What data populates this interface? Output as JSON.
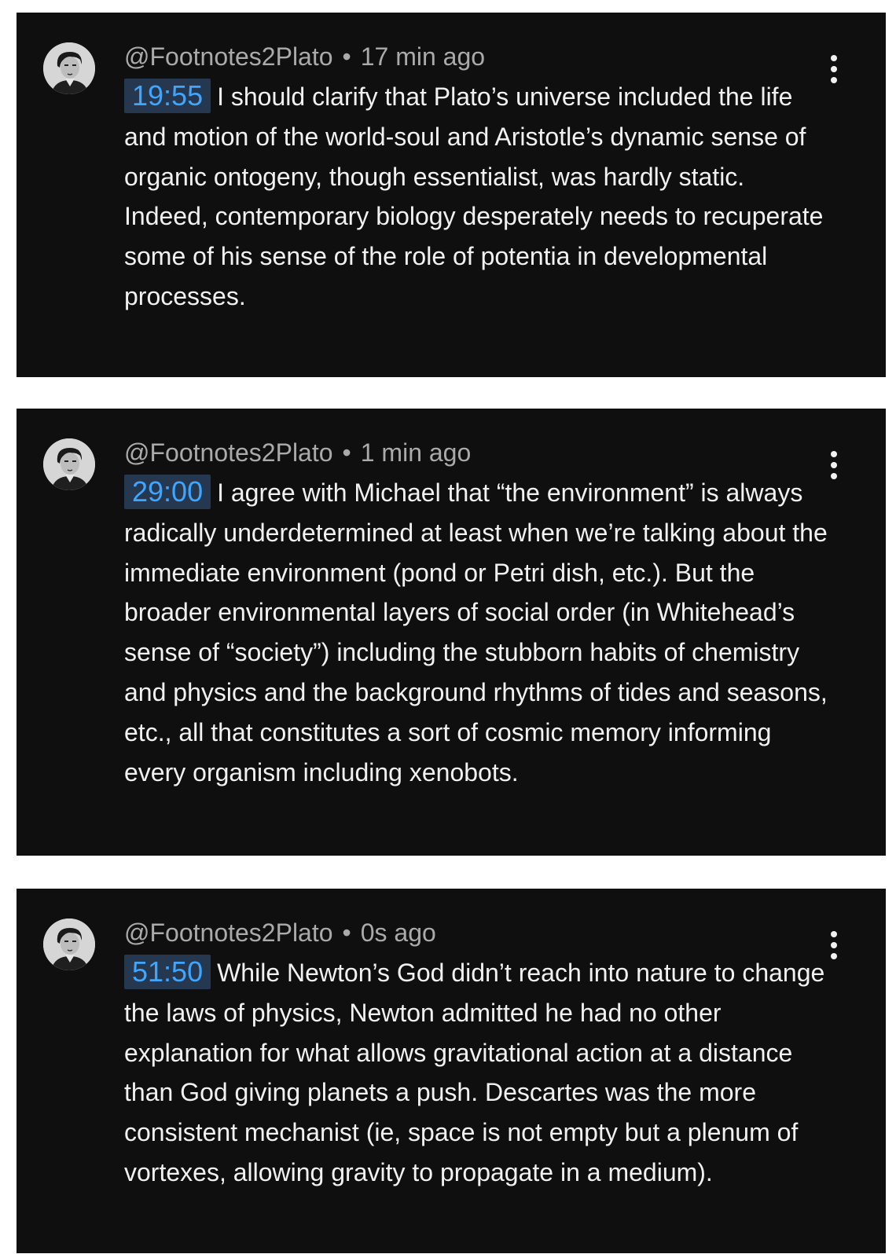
{
  "comments": [
    {
      "author": "@Footnotes2Plato",
      "separator": "•",
      "time_ago": "17 min ago",
      "timestamp": "19:55",
      "text": "I should clarify that Plato’s universe included the life and motion of the world-soul and Aristotle’s dynamic  sense of organic ontogeny, though essentialist, was hardly static. Indeed, contemporary biology desperately needs to recuperate some of his sense of the role of potentia in developmental processes.",
      "avatar_icon": "avatar-portrait",
      "menu_icon": "more-vertical-icon"
    },
    {
      "author": "@Footnotes2Plato",
      "separator": "•",
      "time_ago": "1 min ago",
      "timestamp": "29:00",
      "text": "I agree with Michael that “the environment” is always radically underdetermined at least when we’re talking about the immediate environment (pond or Petri dish, etc.). But the broader environmental layers of social order (in Whitehead’s sense of “society”) including the stubborn habits  of chemistry and physics and the background rhythms of tides and seasons, etc., all that constitutes a sort of cosmic memory informing every organism including xenobots.",
      "avatar_icon": "avatar-portrait",
      "menu_icon": "more-vertical-icon"
    },
    {
      "author": "@Footnotes2Plato",
      "separator": "•",
      "time_ago": "0s ago",
      "timestamp": "51:50",
      "text": "While Newton’s God didn’t reach into nature to change the laws of physics, Newton admitted he had no other explanation for what allows gravitational action at a distance than God giving planets a push. Descartes was the more consistent mechanist (ie, space is not empty but a plenum of vortexes, allowing gravity to propagate in a medium).",
      "avatar_icon": "avatar-portrait",
      "menu_icon": "more-vertical-icon"
    }
  ],
  "colors": {
    "card_background": "#0f0f0f",
    "page_background": "#ffffff",
    "meta_text": "#aaaaaa",
    "body_text": "#f1f1f1",
    "timestamp_text": "#3ea6ff",
    "timestamp_background": "#263850"
  }
}
